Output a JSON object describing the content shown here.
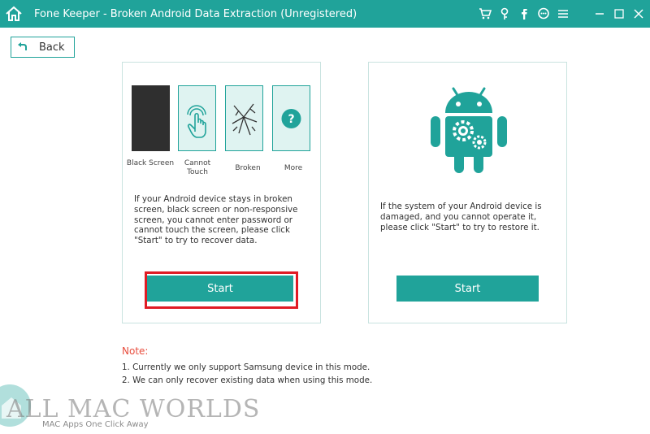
{
  "window": {
    "title": "Fone Keeper - Broken Android Data Extraction (Unregistered)",
    "toolbar_icons": [
      "cart-icon",
      "key-icon",
      "facebook-icon",
      "chat-icon",
      "menu-icon"
    ],
    "controls": [
      "minimize-icon",
      "maximize-icon",
      "close-icon"
    ]
  },
  "back_label": "Back",
  "panel_left": {
    "modes": [
      {
        "label": "Black Screen",
        "icon": "black-screen"
      },
      {
        "label": "Cannot Touch",
        "icon": "touch-hand-icon"
      },
      {
        "label": "Broken",
        "icon": "cracked-screen-icon"
      },
      {
        "label": "More",
        "icon": "question-icon"
      }
    ],
    "description": "If your Android device stays in broken screen, black screen or non-responsive screen, you cannot enter password or cannot touch the screen, please click \"Start\" to try to recover data.",
    "start_label": "Start"
  },
  "panel_right": {
    "icon": "android-gear-icon",
    "description": "If the system of your Android device is damaged, and you cannot operate it, please click \"Start\" to try to restore it.",
    "start_label": "Start"
  },
  "note": {
    "title": "Note:",
    "lines": [
      "1. Currently we only support Samsung device in this mode.",
      "2. We can only recover existing data when using this mode."
    ]
  },
  "watermark": {
    "text": "ALL MAC WORLDS",
    "subtitle": "MAC Apps One Click Away"
  },
  "colors": {
    "accent": "#20a39a",
    "highlight": "#e01b24",
    "note": "#e84d3d"
  }
}
